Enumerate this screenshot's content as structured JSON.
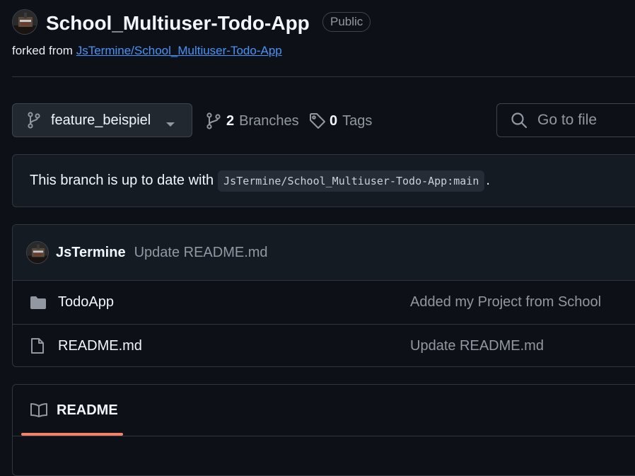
{
  "repo": {
    "title": "School_Multiuser-Todo-App",
    "visibility": "Public",
    "forked_prefix": "forked from",
    "forked_link": "JsTermine/School_Multiuser-Todo-App"
  },
  "toolbar": {
    "branch_name": "feature_beispiel",
    "branches_count": "2",
    "branches_label": "Branches",
    "tags_count": "0",
    "tags_label": "Tags",
    "goto_placeholder": "Go to file"
  },
  "status": {
    "text": "This branch is up to date with",
    "ref": "JsTermine/School_Multiuser-Todo-App:main",
    "suffix": "."
  },
  "latest_commit": {
    "author": "JsTermine",
    "message": "Update README.md"
  },
  "files": [
    {
      "name": "TodoApp",
      "type": "folder",
      "icon": "folder-icon",
      "message": "Added my Project from School"
    },
    {
      "name": "README.md",
      "type": "file",
      "icon": "file-icon",
      "message": "Update README.md"
    }
  ],
  "readme": {
    "tab_label": "README",
    "icon": "book-icon"
  },
  "colors": {
    "background": "#0d1117",
    "link": "#4493f8",
    "tab_underline": "#f78166",
    "muted": "#9198a1"
  }
}
